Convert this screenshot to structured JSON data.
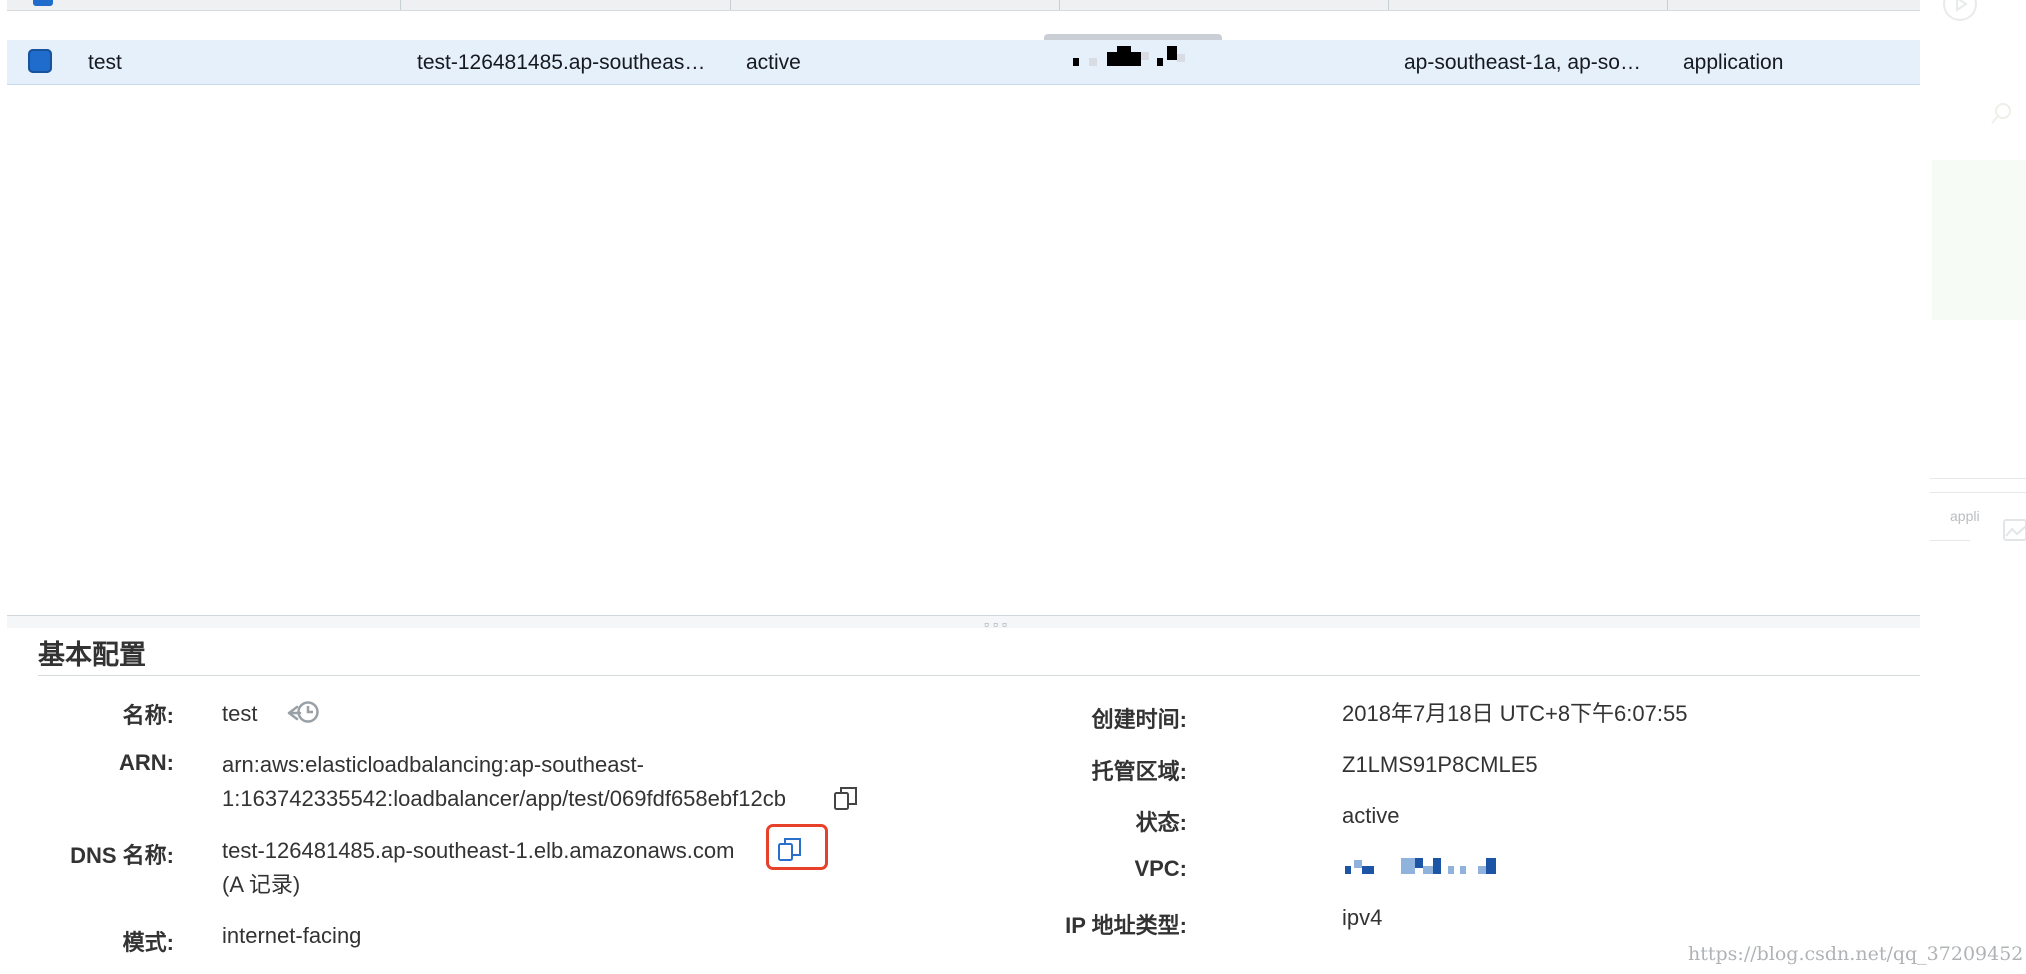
{
  "table": {
    "rows": [
      {
        "name": "test",
        "dns_name": "test-126481485.ap-southeas…",
        "state": "active",
        "availability_zones": "ap-southeast-1a, ap-so…",
        "type": "application"
      }
    ]
  },
  "details": {
    "section_title": "基本配置",
    "left": {
      "name_label": "名称:",
      "name_value": "test",
      "arn_label": "ARN:",
      "arn_line1": "arn:aws:elasticloadbalancing:ap-southeast-",
      "arn_line2": "1:163742335542:loadbalancer/app/test/069fdf658ebf12cb",
      "dns_label": "DNS 名称:",
      "dns_value": "test-126481485.ap-southeast-1.elb.amazonaws.com",
      "dns_record": "(A 记录)",
      "scheme_label": "模式:",
      "scheme_value": "internet-facing"
    },
    "right": {
      "created_label": "创建时间:",
      "created_value": "2018年7月18日 UTC+8下午6:07:55",
      "hosted_zone_label": "托管区域:",
      "hosted_zone_value": "Z1LMS91P8CMLE5",
      "state_label": "状态:",
      "state_value": "active",
      "vpc_label": "VPC:",
      "ip_type_label": "IP 地址类型:",
      "ip_type_value": "ipv4"
    }
  },
  "side_panel": {
    "text1": "appli"
  },
  "watermark": "https://blog.csdn.net/qq_37209452",
  "colors": {
    "selected_row_bg": "#e5f0fb",
    "checkbox_blue": "#1f6ccd",
    "highlight_red": "#e8412a"
  },
  "icons": {
    "copy": "copy-icon",
    "history": "history-icon",
    "checkbox": "checkbox-icon"
  }
}
